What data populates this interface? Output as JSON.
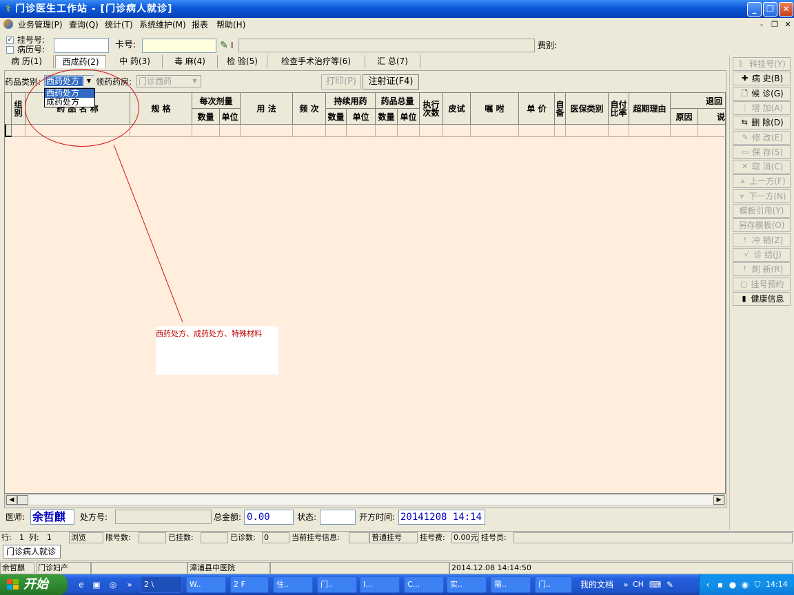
{
  "window": {
    "title": "门诊医生工作站 - [门诊病人就诊]",
    "controls": [
      "_",
      "❐",
      "✕"
    ]
  },
  "menu": {
    "items": [
      "业务管理(P)",
      "查询(Q)",
      "统计(T)",
      "系统维护(M)",
      "报表",
      "帮助(H)"
    ],
    "mdi_controls": [
      "-",
      "❐",
      "✕"
    ]
  },
  "top_form": {
    "registration_no_label": "挂号号:",
    "record_no_label": "病历号:",
    "registration_checked": "✓",
    "card_no_label": "卡号:",
    "card_no_value": "",
    "fee_type_label": "费别:",
    "card_tool_text": "I"
  },
  "tabs": [
    "病 历(1)",
    "西成药(2)",
    "中 药(3)",
    "毒 麻(4)",
    "检 验(5)",
    "检查手术治疗等(6)",
    "汇 总(7)"
  ],
  "prescription": {
    "drug_type_label": "药品类别:",
    "drug_type_value": "西药处方",
    "drug_type_options": [
      "西药处方",
      "成药处方"
    ],
    "pharmacy_label": "领药药房:",
    "pharmacy_value": "门诊西药",
    "print_button": "打印(P)",
    "injection_button": "注射证(F4)"
  },
  "grid": {
    "headers": {
      "group": "组别",
      "drug_name": "药 品 名 称",
      "spec": "规 格",
      "each_dose": "每次剂量",
      "each_qty": "数量",
      "each_unit": "单位",
      "usage": "用 法",
      "frequency": "频 次",
      "continuous": "持续用药",
      "cont_qty": "数量",
      "cont_unit": "单位",
      "total": "药品总量",
      "total_qty": "数量",
      "total_unit": "单位",
      "exec_times": "执行次数",
      "skin_test": "皮试",
      "instructions": "嘱 咐",
      "unit_price": "单 价",
      "self_prepared": "自备",
      "insurance_type": "医保类别",
      "self_pay_ratio": "自付比率",
      "overdue_reason": "超期理由",
      "return": "退回",
      "return_reason": "原因",
      "return_desc": "说"
    }
  },
  "annotation": {
    "text": "西药处方、成药处方、特殊材料"
  },
  "right_toolbar": [
    {
      "icon": "》",
      "label": "转挂号(Y)",
      "enabled": false
    },
    {
      "icon": "✚",
      "label": "病  史(B)",
      "enabled": true
    },
    {
      "icon": "🗋",
      "label": "候  诊(G)",
      "enabled": true
    },
    {
      "icon": "⋮",
      "label": "增  加(A)",
      "enabled": false
    },
    {
      "icon": "⇆",
      "label": "删  除(D)",
      "enabled": true
    },
    {
      "icon": "✎",
      "label": "修  改(E)",
      "enabled": false
    },
    {
      "icon": "▭",
      "label": "保  存(S)",
      "enabled": false
    },
    {
      "icon": "✕",
      "label": "取  消(C)",
      "enabled": false
    },
    {
      "icon": "⩓",
      "label": "上一方(F)",
      "enabled": false
    },
    {
      "icon": "⩔",
      "label": "下一方(N)",
      "enabled": false
    },
    {
      "icon": "",
      "label": "模板引用(Y)",
      "enabled": false
    },
    {
      "icon": "",
      "label": "另存模板(O)",
      "enabled": false
    },
    {
      "icon": "!",
      "label": "冲  销(Z)",
      "enabled": false
    },
    {
      "icon": "√",
      "label": "诊  结(J)",
      "enabled": false
    },
    {
      "icon": "!",
      "label": "刷  新(R)",
      "enabled": false
    },
    {
      "icon": "▢",
      "label": "挂号预约",
      "enabled": false
    },
    {
      "icon": "▮",
      "label": "健康信息",
      "enabled": true
    }
  ],
  "footer": {
    "doctor_label": "医师:",
    "doctor_name": "余哲麒",
    "prescription_no_label": "处方号:",
    "total_amount_label": "总金额:",
    "total_amount": "0.00",
    "status_label": "状态:",
    "open_time_label": "开方时间:",
    "open_time": "20141208 14:14"
  },
  "status_row": {
    "row_label": "行:",
    "row": "1",
    "col_label": "列:",
    "col": "1",
    "mode": "浏览",
    "limit_label": "限号数:",
    "registered_label": "已挂数:",
    "diagnosed_label": "已诊数:",
    "diagnosed": "0",
    "current_reg_label": "当前挂号信息:",
    "reg_type": "普通挂号",
    "reg_fee_label": "挂号费:",
    "reg_fee": "0.00元",
    "registrar_label": "挂号员:"
  },
  "doc_tab": "门诊病人就诊",
  "bottom_status": {
    "user": "余哲麒",
    "department": "门诊妇产",
    "hospital": "漳浦县中医院",
    "datetime": "2014.12.08 14:14:50"
  },
  "taskbar": {
    "start": "开始",
    "items": [
      "2 \\",
      "W..",
      "2 F",
      "住..",
      "门..",
      "I...",
      "C...",
      "实..",
      "需..",
      "门.."
    ],
    "docs": "我的文档",
    "lang": "CH",
    "clock": "14:14"
  },
  "colors": {
    "grid_bg": "#ffeedd",
    "title_blue": "#0a58d8",
    "annotation_red": "#c00000",
    "doctor_blue": "#0000c0"
  }
}
